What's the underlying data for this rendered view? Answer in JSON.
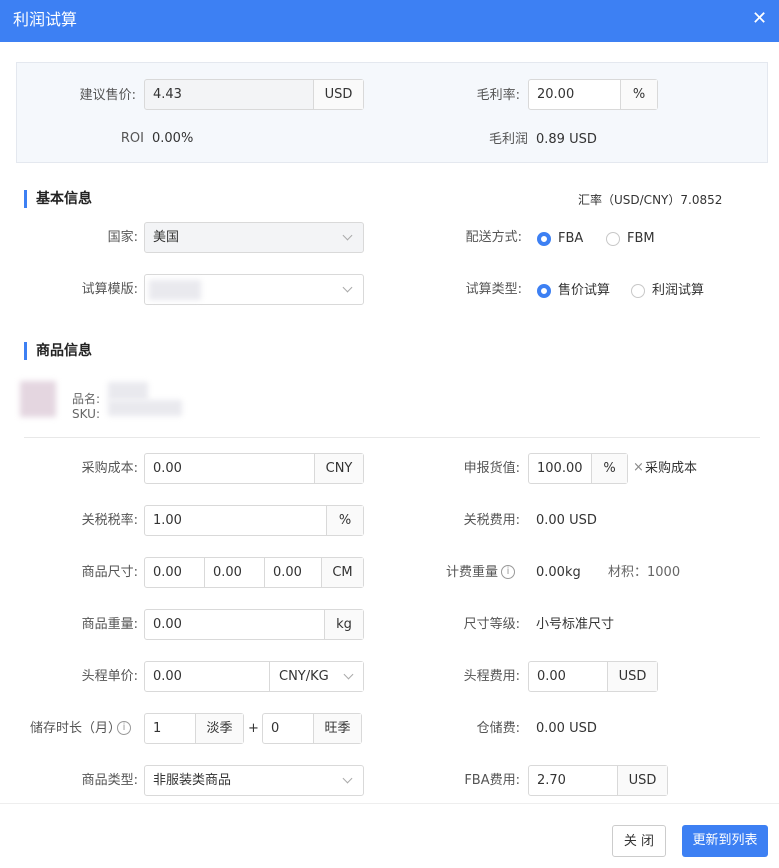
{
  "dialog": {
    "title": "利润试算"
  },
  "summary": {
    "price_label": "建议售价:",
    "price_value": "4.43",
    "price_unit": "USD",
    "margin_label": "毛利率:",
    "margin_value": "20.00",
    "margin_unit": "%",
    "roi_label": "ROI",
    "roi_value": "0.00%",
    "profit_label": "毛利润",
    "profit_value": "0.89 USD"
  },
  "basic": {
    "title": "基本信息",
    "exchange_rate": "汇率（USD/CNY）7.0852",
    "country_label": "国家:",
    "country_value": "美国",
    "template_label": "试算模版:",
    "shipping_label": "配送方式:",
    "shipping_options": [
      "FBA",
      "FBM"
    ],
    "calc_type_label": "试算类型:",
    "calc_type_options": [
      "售价试算",
      "利润试算"
    ]
  },
  "product": {
    "title": "商品信息",
    "name_label": "品名:",
    "sku_label": "SKU:"
  },
  "form": {
    "purchase_cost_label": "采购成本:",
    "purchase_cost_value": "0.00",
    "purchase_cost_unit": "CNY",
    "declared_label": "申报货值:",
    "declared_value": "100.00",
    "declared_unit": "%",
    "declared_suffix": "采购成本",
    "tariff_rate_label": "关税税率:",
    "tariff_rate_value": "1.00",
    "tariff_rate_unit": "%",
    "tariff_fee_label": "关税费用:",
    "tariff_fee_value": "0.00 USD",
    "size_label": "商品尺寸:",
    "size_l": "0.00",
    "size_w": "0.00",
    "size_h": "0.00",
    "size_unit": "CM",
    "billing_weight_label": "计费重量",
    "billing_weight_value": "0.00kg",
    "volume_label": "材积：1000",
    "weight_label": "商品重量:",
    "weight_value": "0.00",
    "weight_unit": "kg",
    "size_tier_label": "尺寸等级:",
    "size_tier_value": "小号标准尺寸",
    "freight_price_label": "头程单价:",
    "freight_price_value": "0.00",
    "freight_price_unit": "CNY/KG",
    "freight_fee_label": "头程费用:",
    "freight_fee_value": "0.00",
    "freight_fee_unit": "USD",
    "storage_label": "储存时长（月）",
    "storage_low_value": "1",
    "storage_low_unit": "淡季",
    "storage_plus": "+",
    "storage_peak_value": "0",
    "storage_peak_unit": "旺季",
    "storage_fee_label": "仓储费:",
    "storage_fee_value": "0.00 USD",
    "category_label": "商品类型:",
    "category_value": "非服装类商品",
    "fba_fee_label": "FBA费用:",
    "fba_fee_value": "2.70",
    "fba_fee_unit": "USD"
  },
  "footer": {
    "close_label": "关 闭",
    "update_label": "更新到列表"
  },
  "colors": {
    "accent": "#3d80f3",
    "positive": "#2ea36a"
  }
}
